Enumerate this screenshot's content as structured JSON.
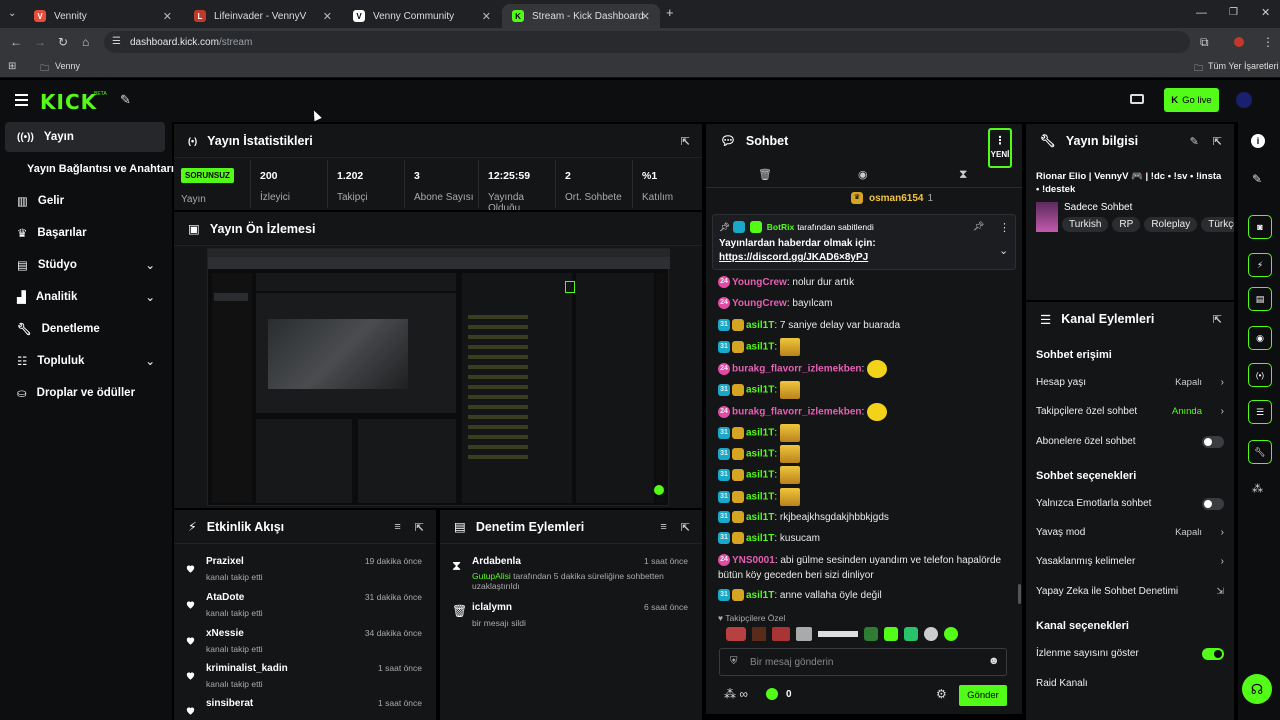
{
  "browser": {
    "tabs": [
      {
        "title": "Vennity",
        "favicon_color": "#e74c3c",
        "favicon": "V"
      },
      {
        "title": "Lifeinvader - VennyV",
        "favicon_color": "#c0392b",
        "favicon": "L"
      },
      {
        "title": "Venny Community",
        "favicon_color": "#ffffff",
        "favicon": "V"
      },
      {
        "title": "Stream - Kick Dashboard",
        "favicon_color": "#53fc18",
        "favicon": "K"
      }
    ],
    "url_host": "dashboard.kick.com",
    "url_path": "/stream",
    "bookmark": "Venny",
    "all_bookmarks": "Tüm Yer İşaretleri"
  },
  "topnav": {
    "logo": "KICK",
    "beta": "BETA",
    "go_live": "Go live"
  },
  "sidebar": {
    "items": [
      {
        "label": "Yayın",
        "icon": "broadcast-icon",
        "active": true
      },
      {
        "label": "Yayın Bağlantısı ve Anahtarı",
        "icon": "",
        "active": false
      },
      {
        "label": "Gelir",
        "icon": "chart-icon",
        "active": false
      },
      {
        "label": "Başarılar",
        "icon": "trophy-icon",
        "active": false
      },
      {
        "label": "Stüdyo",
        "icon": "studio-icon",
        "active": false,
        "expand": true
      },
      {
        "label": "Analitik",
        "icon": "analytics-icon",
        "active": false,
        "expand": true
      },
      {
        "label": "Denetleme",
        "icon": "wrench-icon",
        "active": false
      },
      {
        "label": "Topluluk",
        "icon": "community-icon",
        "active": false,
        "expand": true
      },
      {
        "label": "Droplar ve ödüller",
        "icon": "drops-icon",
        "active": false
      }
    ]
  },
  "stats": {
    "title": "Yayın İstatistikleri",
    "status": "SORUNSUZ",
    "status_label": "Yayın",
    "items": [
      {
        "value": "200",
        "label": "İzleyici"
      },
      {
        "value": "1.202",
        "label": "Takipçi"
      },
      {
        "value": "3",
        "label": "Abone Sayısı"
      },
      {
        "value": "12:25:59",
        "label": "Yayında Olduğu"
      },
      {
        "value": "2",
        "label": "Ort. Sohbete"
      },
      {
        "value": "%1",
        "label": "Katılım"
      }
    ]
  },
  "preview": {
    "title": "Yayın Ön İzlemesi"
  },
  "activity": {
    "title": "Etkinlik Akışı",
    "items": [
      {
        "user": "Prazixel",
        "action": "kanalı takip etti",
        "time": "19 dakika önce"
      },
      {
        "user": "AtaDote",
        "action": "kanalı takip etti",
        "time": "31 dakika önce"
      },
      {
        "user": "xNessie",
        "action": "kanalı takip etti",
        "time": "34 dakika önce"
      },
      {
        "user": "kriminalist_kadin",
        "action": "kanalı takip etti",
        "time": "1 saat önce"
      },
      {
        "user": "sinsiberat",
        "action": "",
        "time": "1 saat önce"
      }
    ]
  },
  "moderation": {
    "title": "Denetim Eylemleri",
    "items": [
      {
        "user": "Ardabenla",
        "actor": "GutupAlisi",
        "detail": " tarafından 5 dakika süreliğine sohbetten uzaklaştırıldı",
        "time": "1 saat önce"
      },
      {
        "user": "iclalymn",
        "actor": "",
        "detail": "bir mesajı sildi",
        "time": "6 saat önce"
      }
    ]
  },
  "chat": {
    "title": "Sohbet",
    "new_label": "YENİ",
    "top_user": "osman6154",
    "top_count": "1",
    "pinned": {
      "by": "BotRix",
      "by_suffix": "tarafından sabitlendi",
      "text": "Yayınlardan haberdar olmak için:",
      "link": "https://discord.gg/JKAD6×8yPJ"
    },
    "messages": [
      {
        "badge": "24",
        "user": "YoungCrew",
        "color": "pink",
        "text": "nolur dur artık"
      },
      {
        "badge": "24",
        "user": "YoungCrew",
        "color": "pink",
        "text": "bayılcam"
      },
      {
        "badge": "31",
        "user": "asil1T",
        "color": "green",
        "text": "7 saniye delay var buarada"
      },
      {
        "badge": "31",
        "user": "asil1T",
        "color": "green",
        "text": "",
        "emote": true
      },
      {
        "badge": "24",
        "user": "burakg_flavorr_izlemekben",
        "color": "pink",
        "text": "",
        "emote": true
      },
      {
        "badge": "31",
        "user": "asil1T",
        "color": "green",
        "text": "",
        "emote": true
      },
      {
        "badge": "24",
        "user": "burakg_flavorr_izlemekben",
        "color": "pink",
        "text": "",
        "emote": true
      },
      {
        "badge": "31",
        "user": "asil1T",
        "color": "green",
        "text": "",
        "emote": true
      },
      {
        "badge": "31",
        "user": "asil1T",
        "color": "green",
        "text": "",
        "emote": true
      },
      {
        "badge": "31",
        "user": "asil1T",
        "color": "green",
        "text": "",
        "emote": true
      },
      {
        "badge": "31",
        "user": "asil1T",
        "color": "green",
        "text": "",
        "emote": true
      },
      {
        "badge": "31",
        "user": "asil1T",
        "color": "green",
        "text": "rkjbeajkhsgdakjhbbkjgds"
      },
      {
        "badge": "31",
        "user": "asil1T",
        "color": "green",
        "text": "kusucam"
      },
      {
        "badge": "24",
        "user": "YNS0001",
        "color": "pink",
        "text": "abi gülme sesinden uyandım ve telefon hapalörde bütün köy geceden beri sizi dinliyor"
      },
      {
        "badge": "31",
        "user": "asil1T",
        "color": "green",
        "text": "anne vallaha öyle değil"
      }
    ],
    "followers_only": "Takipçilere Özel",
    "input_placeholder": "Bir mesaj gönderin",
    "infinite": "∞",
    "points": "0",
    "send": "Gönder"
  },
  "info": {
    "title": "Yayın bilgisi",
    "stream_title": "Rionar Elio | VennyV 🎮 | !dc • !sv • !insta • !destek",
    "category": "Sadece Sohbet",
    "tags": [
      "Turkish",
      "RP",
      "Roleplay",
      "Türkçe"
    ]
  },
  "channel_actions": {
    "title": "Kanal Eylemleri",
    "chat_access": "Sohbet erişimi",
    "account_age": "Hesap yaşı",
    "account_age_val": "Kapalı",
    "followers_chat": "Takipçilere özel sohbet",
    "followers_chat_val": "Anında",
    "subs_chat": "Abonelere özel sohbet",
    "chat_options": "Sohbet seçenekleri",
    "emote_only": "Yalnızca Emotlarla sohbet",
    "slow_mode": "Yavaş mod",
    "slow_mode_val": "Kapalı",
    "banned_words": "Yasaklanmış kelimeler",
    "ai_mod": "Yapay Zeka ile Sohbet Denetimi",
    "channel_options": "Kanal seçenekleri",
    "show_viewers": "İzlenme sayısını göster",
    "raid": "Raid Kanalı"
  },
  "colors": {
    "brand": "#53fc18",
    "panel": "#141517",
    "sidebar": "#0d0e10"
  }
}
